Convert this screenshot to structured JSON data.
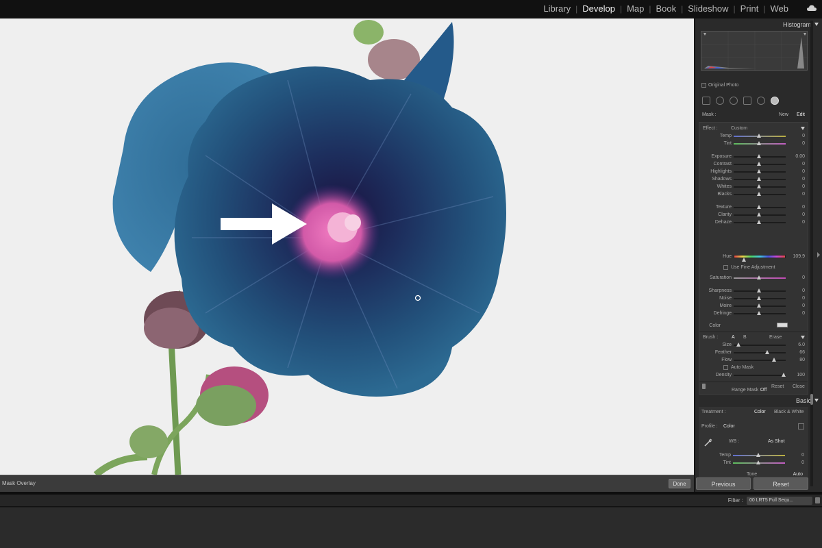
{
  "modules": {
    "items": [
      {
        "label": "Library"
      },
      {
        "label": "Develop"
      },
      {
        "label": "Map"
      },
      {
        "label": "Book"
      },
      {
        "label": "Slideshow"
      },
      {
        "label": "Print"
      },
      {
        "label": "Web"
      }
    ],
    "active": "Develop"
  },
  "toolbar": {
    "mask_overlay_label": "Mask Overlay",
    "done_label": "Done"
  },
  "filmstrip": {
    "filter_label": "Filter :",
    "filter_value": "00 LRT5 Full Sequ..."
  },
  "histogram": {
    "title": "Histogram",
    "original_photo_label": "Original Photo"
  },
  "mask": {
    "label": "Mask :",
    "new_label": "New",
    "edit_label": "Edit"
  },
  "effect": {
    "label": "Effect :",
    "value": "Custom",
    "sliders": [
      {
        "label": "Temp",
        "value": "0",
        "pos": 0.5
      },
      {
        "label": "Tint",
        "value": "0",
        "pos": 0.5
      },
      {
        "label": "Exposure",
        "value": "0.00",
        "pos": 0.5
      },
      {
        "label": "Contrast",
        "value": "0",
        "pos": 0.5
      },
      {
        "label": "Highlights",
        "value": "0",
        "pos": 0.5
      },
      {
        "label": "Shadows",
        "value": "0",
        "pos": 0.5
      },
      {
        "label": "Whites",
        "value": "0",
        "pos": 0.5
      },
      {
        "label": "Blacks",
        "value": "0",
        "pos": 0.5
      },
      {
        "label": "Texture",
        "value": "0",
        "pos": 0.5
      },
      {
        "label": "Clarity",
        "value": "0",
        "pos": 0.5
      },
      {
        "label": "Dehaze",
        "value": "0",
        "pos": 0.5
      }
    ],
    "hue": {
      "label": "Hue",
      "value": "109.9",
      "pos": 0.2
    },
    "fine_adjust_label": "Use Fine Adjustment",
    "saturation": {
      "label": "Saturation",
      "value": "0",
      "pos": 0.5
    },
    "detail_sliders": [
      {
        "label": "Sharpness",
        "value": "0",
        "pos": 0.5
      },
      {
        "label": "Noise",
        "value": "0",
        "pos": 0.5
      },
      {
        "label": "Moire",
        "value": "0",
        "pos": 0.5
      },
      {
        "label": "Defringe",
        "value": "0",
        "pos": 0.5
      }
    ],
    "color_label": "Color"
  },
  "brush": {
    "label": "Brush :",
    "tab_a": "A",
    "tab_b": "B",
    "erase": "Erase",
    "sliders": [
      {
        "label": "Size",
        "value": "6.0",
        "pos": 0.1
      },
      {
        "label": "Feather",
        "value": "66",
        "pos": 0.66
      },
      {
        "label": "Flow",
        "value": "80",
        "pos": 0.8
      }
    ],
    "auto_mask_label": "Auto Mask",
    "density": {
      "label": "Density",
      "value": "100",
      "pos": 1.0
    }
  },
  "range_mask": {
    "label": "Range Mask :",
    "value": "Off"
  },
  "mask_footer": {
    "reset": "Reset",
    "close": "Close"
  },
  "basic": {
    "title": "Basic",
    "treatment_label": "Treatment :",
    "color_option": "Color",
    "bw_option": "Black & White",
    "profile_label": "Profile :",
    "profile_value": "Color",
    "wb_label": "WB :",
    "wb_value": "As Shot",
    "temp": {
      "label": "Temp",
      "value": "0"
    },
    "tint": {
      "label": "Tint",
      "value": "0"
    },
    "tone_label": "Tone",
    "auto_label": "Auto"
  },
  "buttons": {
    "previous": "Previous",
    "reset": "Reset"
  }
}
